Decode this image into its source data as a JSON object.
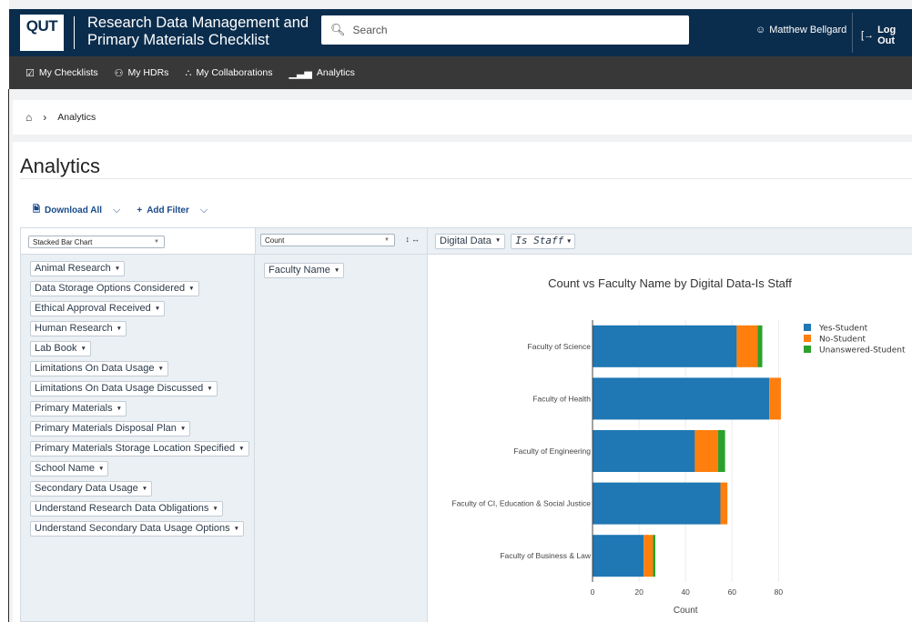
{
  "header": {
    "logo_text": "QUT",
    "title_line1": "Research Data Management and",
    "title_line2": "Primary Materials Checklist",
    "search_placeholder": "Search",
    "user_name": "Matthew Bellgard",
    "logout_label": "Log Out",
    "icons": [
      "search-icon",
      "user-icon",
      "logout-icon"
    ]
  },
  "nav": {
    "items": [
      {
        "label": "My Checklists",
        "icon": "checkbox-icon"
      },
      {
        "label": "My HDRs",
        "icon": "people-icon"
      },
      {
        "label": "My Collaborations",
        "icon": "network-icon"
      },
      {
        "label": "Analytics",
        "icon": "bar-chart-icon"
      }
    ]
  },
  "breadcrumb": {
    "current": "Analytics"
  },
  "page": {
    "title": "Analytics"
  },
  "toolbar": {
    "download_label": "Download All",
    "add_filter_label": "Add Filter"
  },
  "pivot": {
    "renderer": "Stacked Bar Chart",
    "aggregator": "Count",
    "column_fields": [
      "Digital Data",
      "Is Staff"
    ],
    "row_fields": [
      "Faculty Name"
    ],
    "unused_fields": [
      "Animal Research",
      "Data Storage Options Considered",
      "Ethical Approval Received",
      "Human Research",
      "Lab Book",
      "Limitations On Data Usage",
      "Limitations On Data Usage Discussed",
      "Primary Materials",
      "Primary Materials Disposal Plan",
      "Primary Materials Storage Location Specified",
      "School Name",
      "Secondary Data Usage",
      "Understand Research Data Obligations",
      "Understand Secondary Data Usage Options"
    ]
  },
  "chart_data": {
    "type": "bar",
    "orientation": "horizontal",
    "stacked": true,
    "title": "Count vs Faculty Name by Digital Data-Is Staff",
    "xlabel": "Count",
    "ylabel": "",
    "xlim": [
      0,
      90
    ],
    "xticks": [
      0,
      20,
      40,
      60,
      80
    ],
    "categories": [
      "Faculty of Science",
      "Faculty of Health",
      "Faculty of Engineering",
      "Faculty of CI, Education & Social Justice",
      "Faculty of Business & Law"
    ],
    "series": [
      {
        "name": "Yes-Student",
        "color": "#1f77b4",
        "values": [
          62,
          76,
          44,
          55,
          22
        ]
      },
      {
        "name": "No-Student",
        "color": "#ff7f0e",
        "values": [
          9,
          5,
          10,
          3,
          4
        ]
      },
      {
        "name": "Unanswered-Student",
        "color": "#2ca02c",
        "values": [
          2,
          0,
          3,
          0,
          1
        ]
      }
    ],
    "legend_position": "top-right",
    "grid": true
  }
}
